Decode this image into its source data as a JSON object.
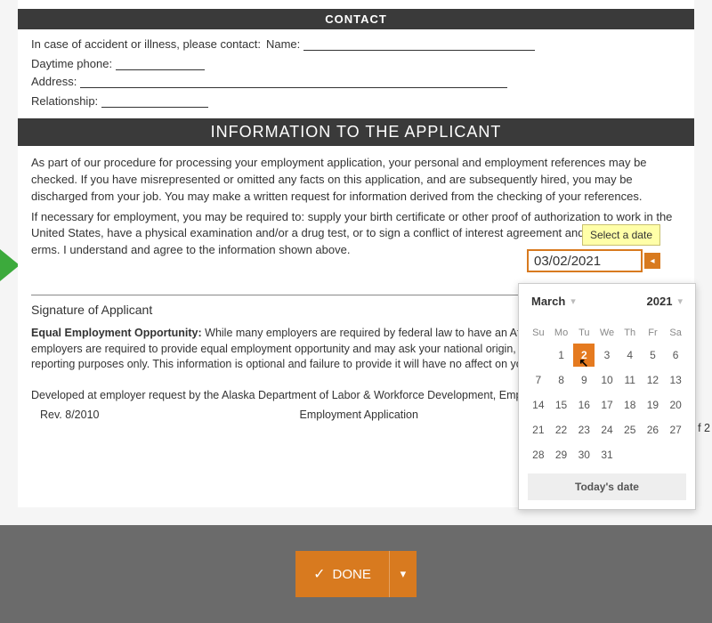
{
  "contact": {
    "header": "CONTACT",
    "line1": "In case of accident or illness, please contact:",
    "name_label": "Name:",
    "daytime_label": "Daytime phone:",
    "address_label": "Address:",
    "relationship_label": "Relationship:"
  },
  "section": {
    "title": "INFORMATION TO THE APPLICANT",
    "para1": "As part of our procedure for processing your employment application, your personal and employment references may be checked. If you have misrepresented or omitted any facts on this application, and are subsequently hired, you may be discharged from your job. You may make a written request for information derived from the checking of your references.",
    "para2_a": "If necessary for employment, you may be required to: supply your birth certificate or other proof of authorization to work in the United States, have a physical examination and/or a drug test, or to sign a conflict of interest agreement and",
    "para2_b": "erms. I understand and agree to the information shown above."
  },
  "signature_label": "Signature of Applicant",
  "eeo": {
    "bold": "Equal Employment Opportunity:",
    "text": " While many employers are required by federal law to have an Affirmative Action Program, all employers are required to provide equal employment opportunity and may ask your national origin, race and sex for planning and reporting purposes only. This information is optional and failure to provide it will have no affect on your application for employment."
  },
  "footer": {
    "dev": "Developed at employer request by the Alaska Department of Labor & Workforce Development, Employment Security Division.",
    "rev": "Rev. 8/2010",
    "doc": "Employment Application",
    "page_edge": "f 2"
  },
  "date": {
    "tooltip": "Select a date",
    "value": "03/02/2021",
    "month": "March",
    "year": "2021",
    "dow": [
      "Su",
      "Mo",
      "Tu",
      "We",
      "Th",
      "Fr",
      "Sa"
    ],
    "selected_day": 2,
    "last_day": 31,
    "start_offset": 1,
    "today_label": "Today's date"
  },
  "actions": {
    "done": "DONE"
  }
}
